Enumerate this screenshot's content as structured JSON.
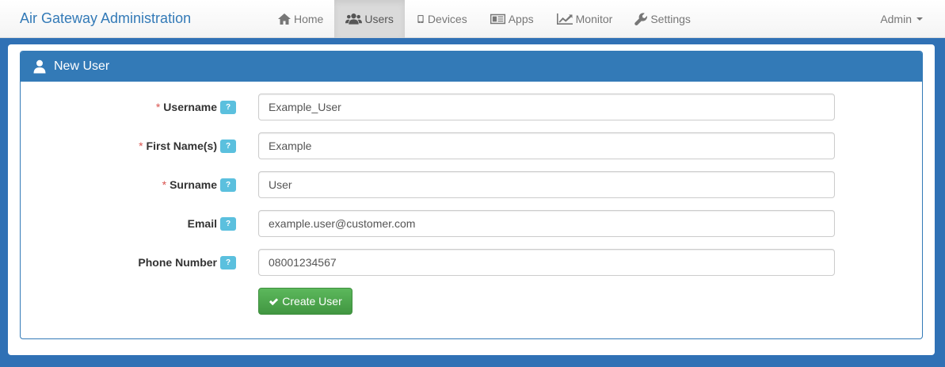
{
  "navbar": {
    "brand": "Air Gateway Administration",
    "items": [
      {
        "label": "Home",
        "icon": "home-icon",
        "active": false
      },
      {
        "label": "Users",
        "icon": "users-icon",
        "active": true
      },
      {
        "label": "Devices",
        "icon": "mobile-icon",
        "active": false
      },
      {
        "label": "Apps",
        "icon": "apps-icon",
        "active": false
      },
      {
        "label": "Monitor",
        "icon": "chart-line-icon",
        "active": false
      },
      {
        "label": "Settings",
        "icon": "wrench-icon",
        "active": false
      }
    ],
    "user_menu": "Admin"
  },
  "panel": {
    "title": "New User",
    "icon": "user-icon"
  },
  "form": {
    "required_marker": "*",
    "help_label": "?",
    "fields": [
      {
        "label": "Username",
        "value": "Example_User",
        "required": true
      },
      {
        "label": "First Name(s)",
        "value": "Example",
        "required": true
      },
      {
        "label": "Surname",
        "value": "User",
        "required": true
      },
      {
        "label": "Email",
        "value": "example.user@customer.com",
        "required": false
      },
      {
        "label": "Phone Number",
        "value": "08001234567",
        "required": false
      }
    ],
    "submit_label": "Create User",
    "submit_icon": "check-icon"
  },
  "colors": {
    "brand": "#337ab7",
    "background": "#3071b5",
    "success": "#5cb85c",
    "info": "#5bc0de",
    "required": "#d9534f"
  }
}
